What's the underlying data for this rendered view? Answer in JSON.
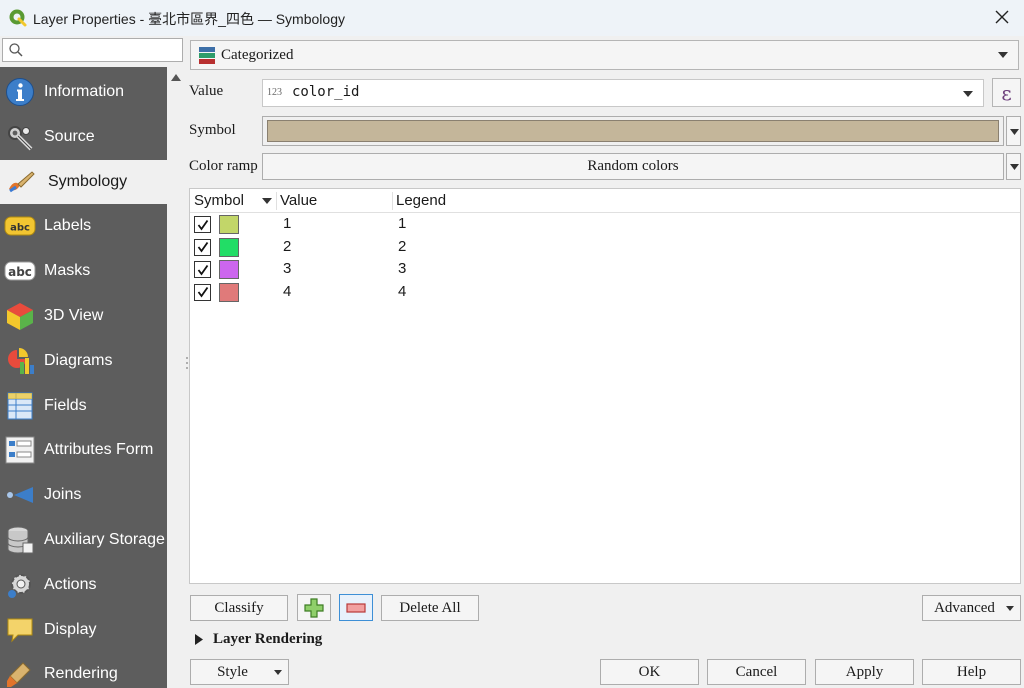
{
  "window": {
    "title": "Layer Properties - 臺北市區界_四色 — Symbology"
  },
  "sidebar": {
    "search_placeholder": "",
    "items": [
      {
        "label": "Information",
        "icon": "information-icon",
        "selected": false
      },
      {
        "label": "Source",
        "icon": "source-icon",
        "selected": false
      },
      {
        "label": "Symbology",
        "icon": "symbology-icon",
        "selected": true
      },
      {
        "label": "Labels",
        "icon": "labels-icon",
        "selected": false
      },
      {
        "label": "Masks",
        "icon": "masks-icon",
        "selected": false
      },
      {
        "label": "3D View",
        "icon": "3d-view-icon",
        "selected": false
      },
      {
        "label": "Diagrams",
        "icon": "diagrams-icon",
        "selected": false
      },
      {
        "label": "Fields",
        "icon": "fields-icon",
        "selected": false
      },
      {
        "label": "Attributes Form",
        "icon": "attributes-form-icon",
        "selected": false
      },
      {
        "label": "Joins",
        "icon": "joins-icon",
        "selected": false
      },
      {
        "label": "Auxiliary Storage",
        "icon": "auxiliary-storage-icon",
        "selected": false
      },
      {
        "label": "Actions",
        "icon": "actions-icon",
        "selected": false
      },
      {
        "label": "Display",
        "icon": "display-icon",
        "selected": false
      },
      {
        "label": "Rendering",
        "icon": "rendering-icon",
        "selected": false
      }
    ]
  },
  "symbology": {
    "renderer": "Categorized",
    "value_label": "Value",
    "value_type": "123",
    "value_field": "color_id",
    "expression_glyph": "ε",
    "symbol_label": "Symbol",
    "symbol_color": "#c4b69a",
    "color_ramp_label": "Color ramp",
    "color_ramp_value": "Random colors",
    "table": {
      "headers": {
        "symbol": "Symbol",
        "value": "Value",
        "legend": "Legend"
      },
      "rows": [
        {
          "checked": true,
          "color": "#c2d669",
          "value": "1",
          "legend": "1"
        },
        {
          "checked": true,
          "color": "#22dd66",
          "value": "2",
          "legend": "2"
        },
        {
          "checked": true,
          "color": "#cc66ee",
          "value": "3",
          "legend": "3"
        },
        {
          "checked": true,
          "color": "#e07a7a",
          "value": "4",
          "legend": "4"
        }
      ]
    },
    "classify_label": "Classify",
    "delete_all_label": "Delete All",
    "advanced_label": "Advanced",
    "layer_rendering_label": "Layer Rendering"
  },
  "footer": {
    "style_label": "Style",
    "ok_label": "OK",
    "cancel_label": "Cancel",
    "apply_label": "Apply",
    "help_label": "Help"
  }
}
